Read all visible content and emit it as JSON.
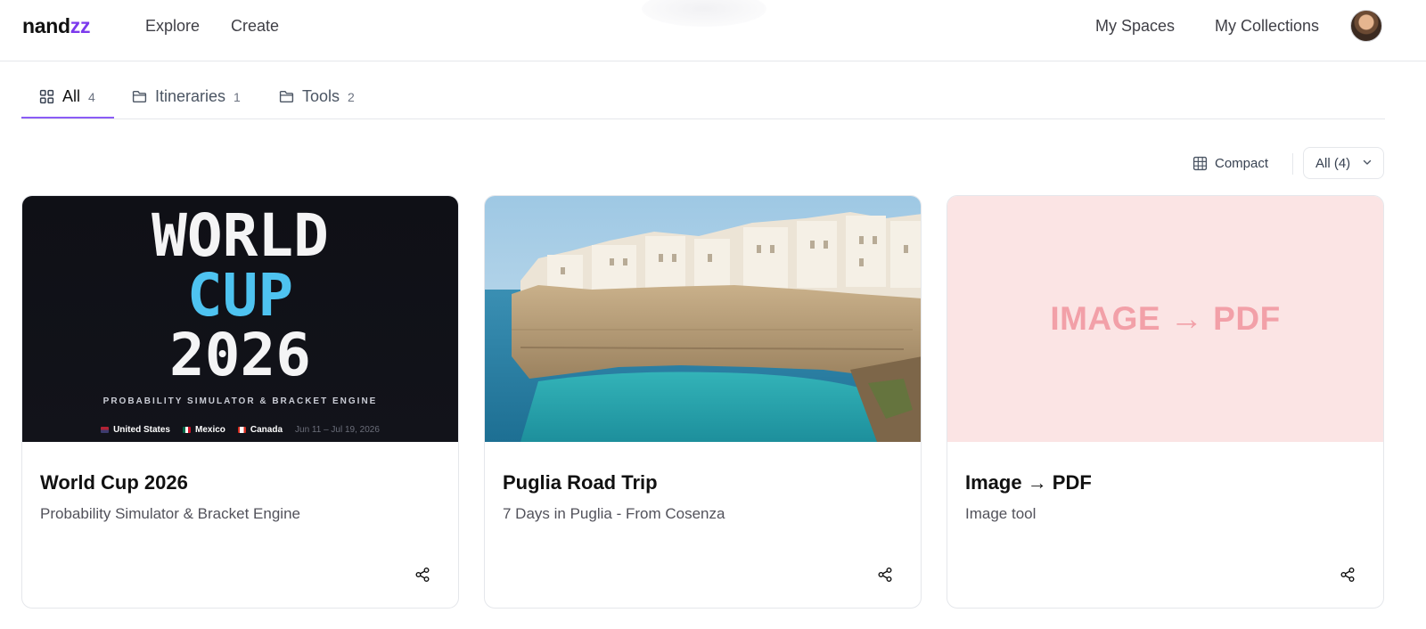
{
  "header": {
    "logo_main": "nand",
    "logo_accent": "zz",
    "nav": [
      {
        "label": "Explore"
      },
      {
        "label": "Create"
      }
    ],
    "right_nav": [
      {
        "label": "My Spaces"
      },
      {
        "label": "My Collections"
      }
    ],
    "avatar_icon": "user-avatar-icon"
  },
  "tabs": [
    {
      "label": "All",
      "count": "4",
      "icon": "grid-icon",
      "active": true
    },
    {
      "label": "Itineraries",
      "count": "1",
      "icon": "folder-icon",
      "active": false
    },
    {
      "label": "Tools",
      "count": "2",
      "icon": "folder-icon",
      "active": false
    }
  ],
  "toolbar": {
    "view_label": "Compact",
    "filter_value": "All (4)"
  },
  "cards": [
    {
      "title": "World Cup 2026",
      "subtitle": "Probability Simulator & Bracket Engine",
      "media": {
        "line1": "WORLD",
        "line2": "CUP",
        "line3": "2026",
        "tagline": "PROBABILITY SIMULATOR & BRACKET ENGINE",
        "countries": [
          "United States",
          "Mexico",
          "Canada"
        ],
        "dates": "Jun 11 – Jul 19, 2026"
      }
    },
    {
      "title": "Puglia Road Trip",
      "subtitle": "7 Days in Puglia - From Cosenza"
    },
    {
      "title": "Image → PDF",
      "subtitle": "Image tool",
      "media": {
        "text": "IMAGE → PDF"
      }
    }
  ],
  "colors": {
    "accent": "#7c3aed",
    "tab_underline": "#8b5cf6",
    "cup_blue": "#4ec3f0",
    "pdf_pink": "#f2a0a8"
  }
}
